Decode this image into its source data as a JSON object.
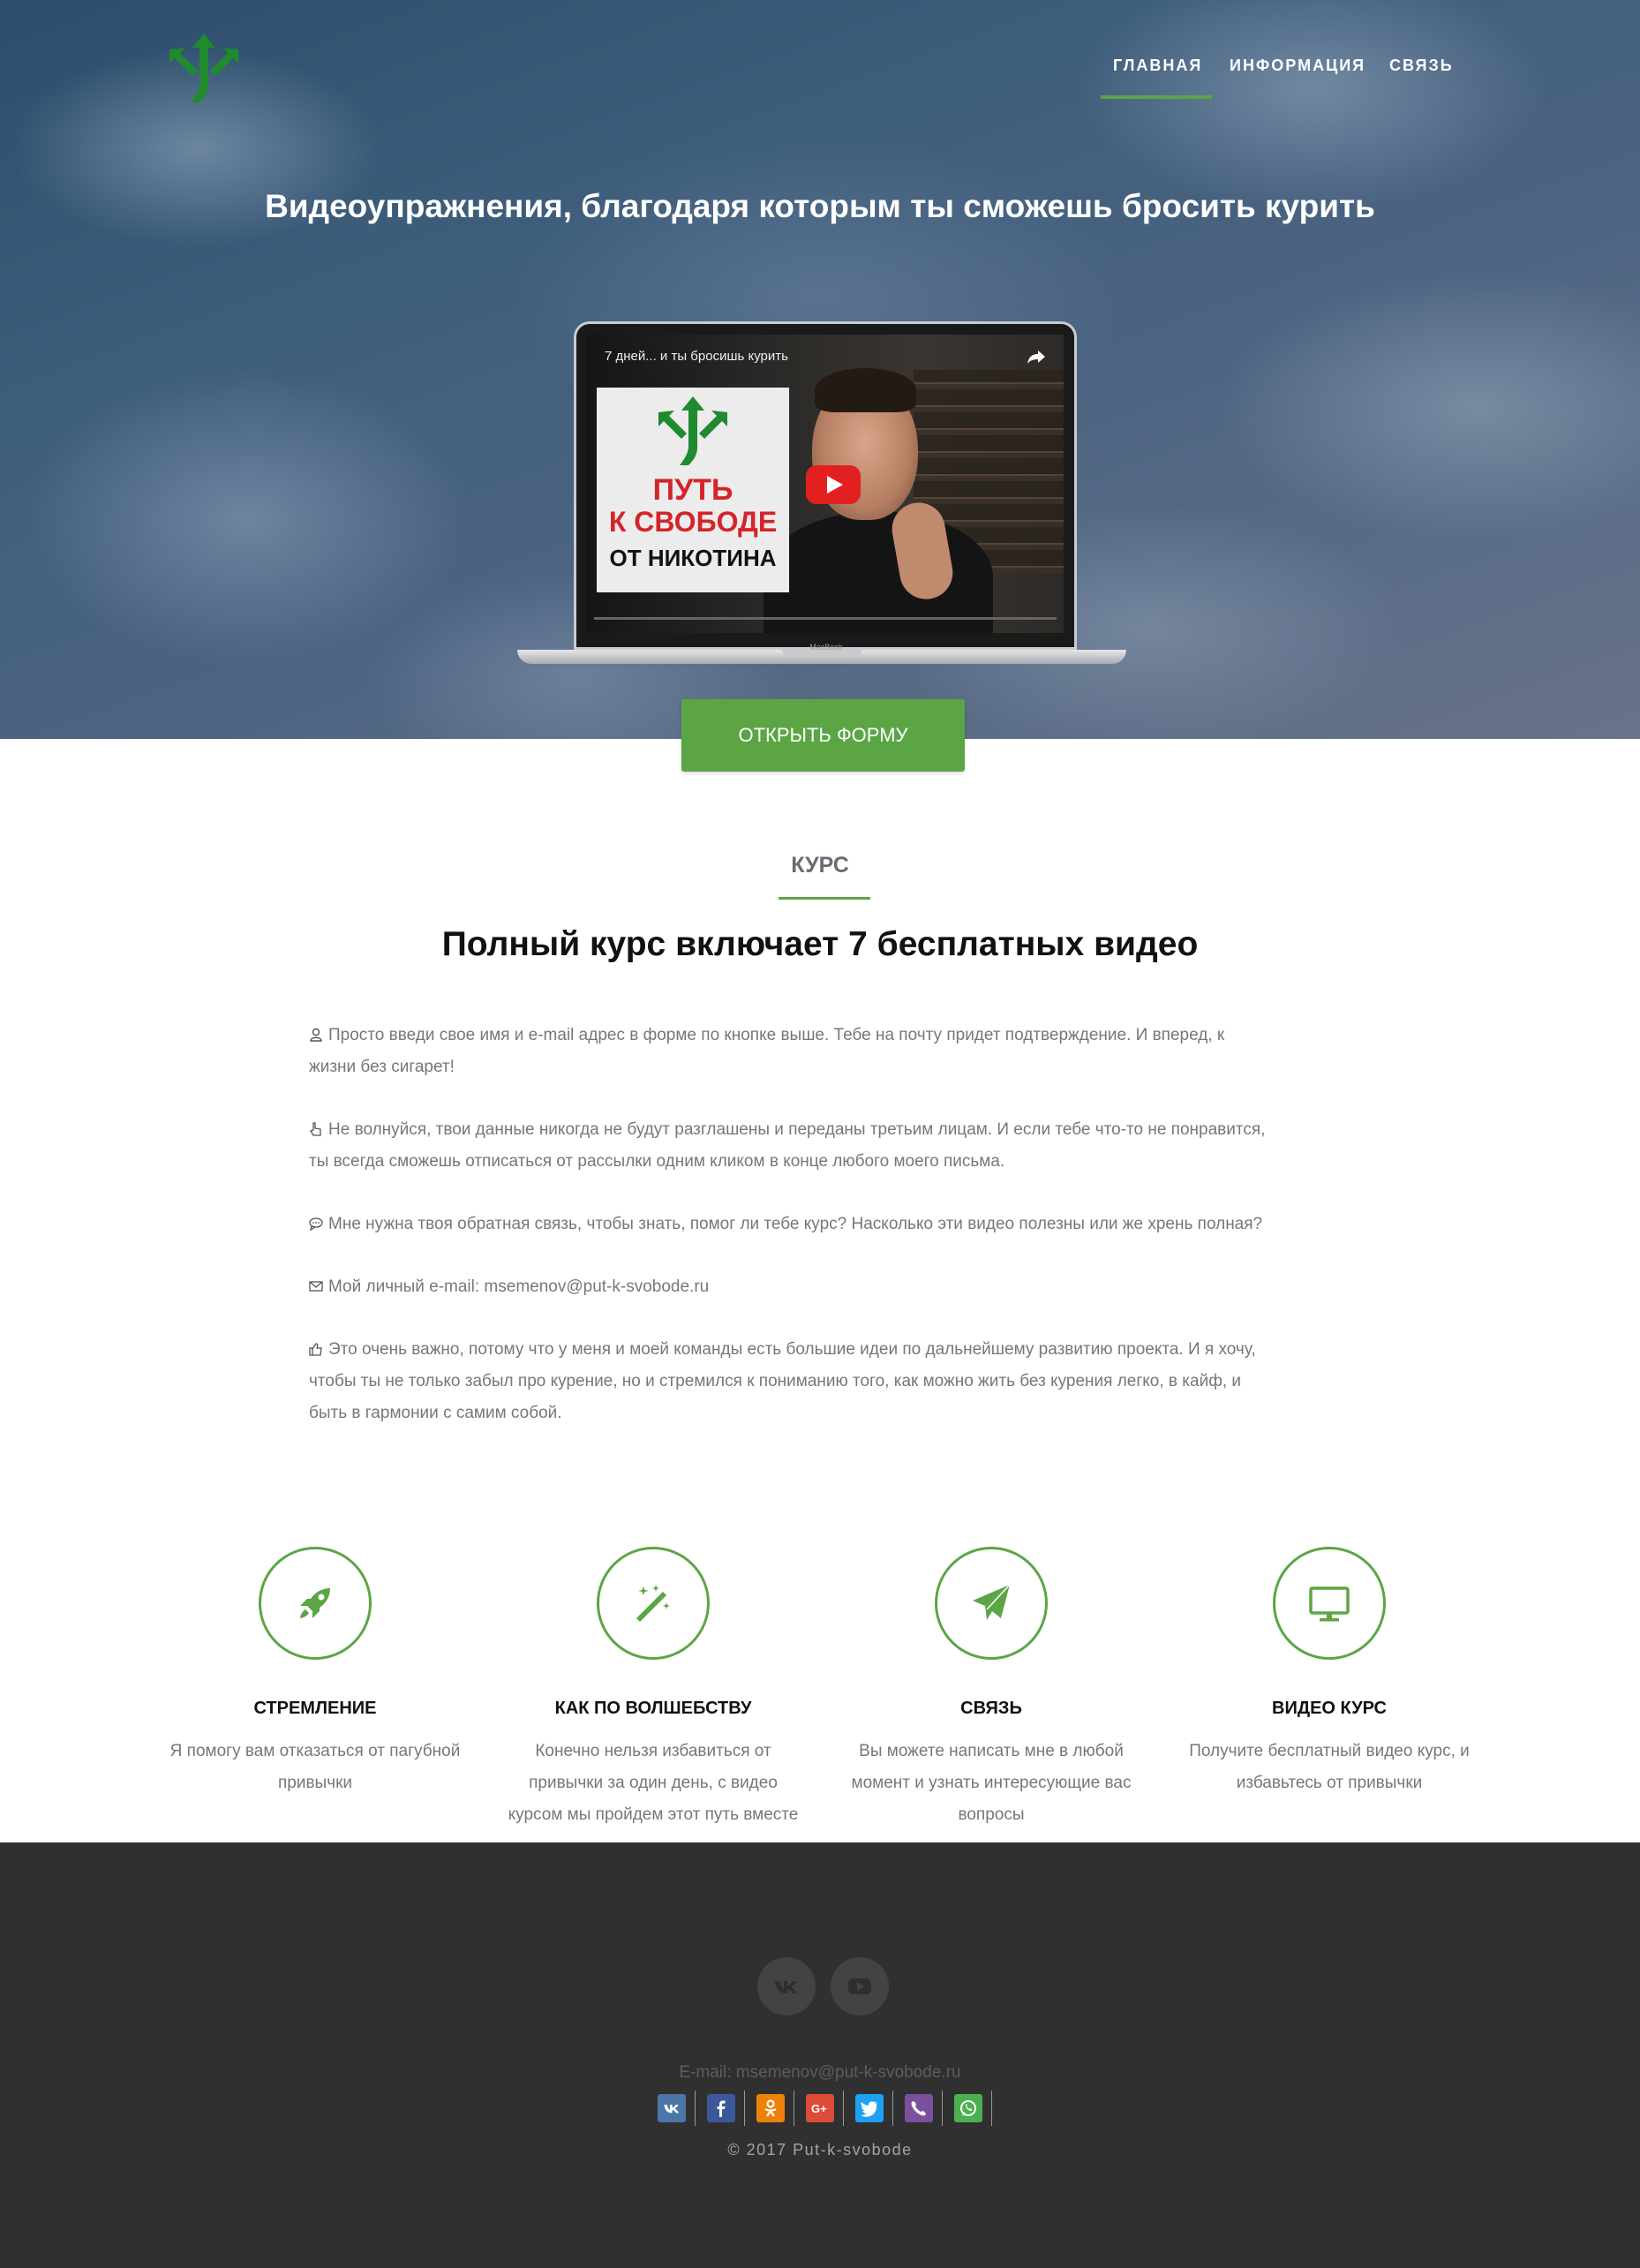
{
  "nav": {
    "items": [
      {
        "label": "ГЛАВНАЯ",
        "active": true
      },
      {
        "label": "ИНФОРМАЦИЯ",
        "active": false
      },
      {
        "label": "СВЯЗЬ",
        "active": false
      }
    ]
  },
  "hero": {
    "title": "Видеоупражнения, благодаря которым ты сможешь бросить курить",
    "video": {
      "title": "7 дней... и ты бросишь курить",
      "thumbnail_line1": "ПУТЬ",
      "thumbnail_line2": "К СВОБОДЕ",
      "thumbnail_line3": "ОТ НИКОТИНА",
      "laptop_label": "MacBook"
    },
    "cta_label": "ОТКРЫТЬ ФОРМУ"
  },
  "course": {
    "label": "КУРС",
    "title": "Полный курс включает 7 бесплатных видео",
    "paragraphs": [
      {
        "icon": "user-icon",
        "text": "Просто введи свое имя и e-mail адрес в форме по кнопке выше. Тебе на почту придет подтверждение. И вперед, к жизни без сигарет!"
      },
      {
        "icon": "hand-pointer-icon",
        "text": "Не волнуйся, твои данные никогда не будут разглашены и переданы третьим лицам. И если тебе что-то не понравится, ты всегда сможешь отписаться от рассылки одним кликом в конце любого моего письма."
      },
      {
        "icon": "comment-icon",
        "text": "Мне нужна твоя обратная связь, чтобы знать, помог ли тебе курс? Насколько эти видео полезны или же хрень полная?"
      },
      {
        "icon": "envelope-icon",
        "text": "Мой личный e-mail: msemenov@put-k-svobode.ru"
      },
      {
        "icon": "thumbs-up-icon",
        "text": "Это очень важно, потому что у меня и моей команды есть большие идеи по дальнейшему развитию проекта. И я хочу, чтобы ты не только забыл про курение, но и стремился к пониманию того, как можно жить без курения легко, в кайф, и быть в гармонии с самим собой."
      }
    ]
  },
  "features": [
    {
      "icon": "rocket-icon",
      "title": "СТРЕМЛЕНИЕ",
      "text": "Я помогу вам отказаться от пагубной привычки"
    },
    {
      "icon": "magic-wand-icon",
      "title": "КАК ПО ВОЛШЕБСТВУ",
      "text": "Конечно нельзя избавиться от привычки за один день, с видео курсом мы пройдем этот путь вместе"
    },
    {
      "icon": "paper-plane-icon",
      "title": "СВЯЗЬ",
      "text": "Вы можете написать мне в любой момент и узнать интересующие вас вопросы"
    },
    {
      "icon": "monitor-icon",
      "title": "ВИДЕО КУРС",
      "text": "Получите бесплатный видео курс, и избавьтесь от привычки"
    }
  ],
  "footer": {
    "social": [
      {
        "icon": "vk-icon"
      },
      {
        "icon": "youtube-icon"
      }
    ],
    "email": "E-mail: msemenov@put-k-svobode.ru",
    "share": [
      {
        "icon": "vk-icon",
        "color": "#4a76a8"
      },
      {
        "icon": "facebook-icon",
        "color": "#3b5998"
      },
      {
        "icon": "odnoklassniki-icon",
        "color": "#ee8208"
      },
      {
        "icon": "google-plus-icon",
        "color": "#dd4b39"
      },
      {
        "icon": "twitter-icon",
        "color": "#1da1f2"
      },
      {
        "icon": "viber-icon",
        "color": "#7b519d"
      },
      {
        "icon": "whatsapp-icon",
        "color": "#4caf50"
      }
    ],
    "copyright": "© 2017 Put-k-svobode"
  },
  "colors": {
    "accent": "#5ca545",
    "footer_bg": "#303030",
    "text_muted": "#777777",
    "heading": "#111111"
  }
}
